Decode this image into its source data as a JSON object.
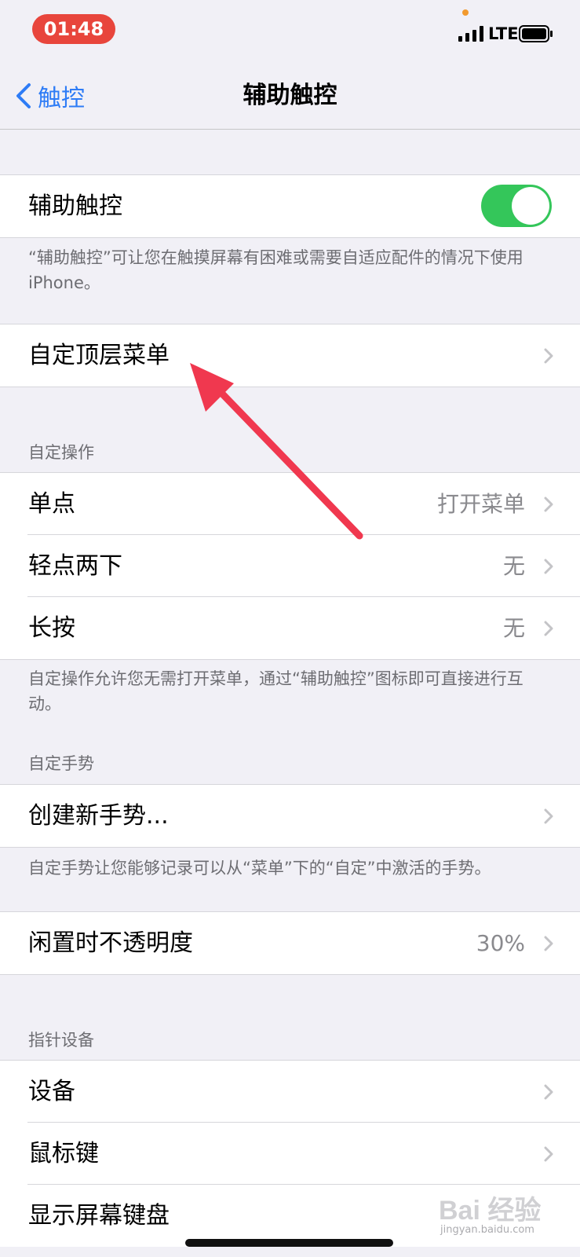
{
  "status_bar": {
    "time": "01:48",
    "network": "LTE"
  },
  "nav": {
    "back_label": "触控",
    "title": "辅助触控"
  },
  "assistive_touch": {
    "label": "辅助触控",
    "enabled": true
  },
  "assistive_touch_footer": "“辅助触控”可让您在触摸屏幕有困难或需要自适应配件的情况下使用iPhone。",
  "customize_menu": {
    "label": "自定顶层菜单"
  },
  "custom_actions": {
    "header": "自定操作",
    "items": [
      {
        "label": "单点",
        "value": "打开菜单"
      },
      {
        "label": "轻点两下",
        "value": "无"
      },
      {
        "label": "长按",
        "value": "无"
      }
    ],
    "footer": "自定操作允许您无需打开菜单，通过“辅助触控”图标即可直接进行互动。"
  },
  "custom_gestures": {
    "header": "自定手势",
    "create_label": "创建新手势...",
    "footer": "自定手势让您能够记录可以从“菜单”下的“自定”中激活的手势。"
  },
  "idle_opacity": {
    "label": "闲置时不透明度",
    "value": "30%"
  },
  "pointer_devices": {
    "header": "指针设备",
    "items": [
      {
        "label": "设备"
      },
      {
        "label": "鼠标键"
      },
      {
        "label": "显示屏幕键盘"
      }
    ]
  },
  "watermark": {
    "brand": "Bai 经验",
    "url": "jingyan.baidu.com"
  },
  "colors": {
    "accent": "#2e7cf6",
    "toggle_on": "#34c65a",
    "annotation": "#f0384f"
  }
}
